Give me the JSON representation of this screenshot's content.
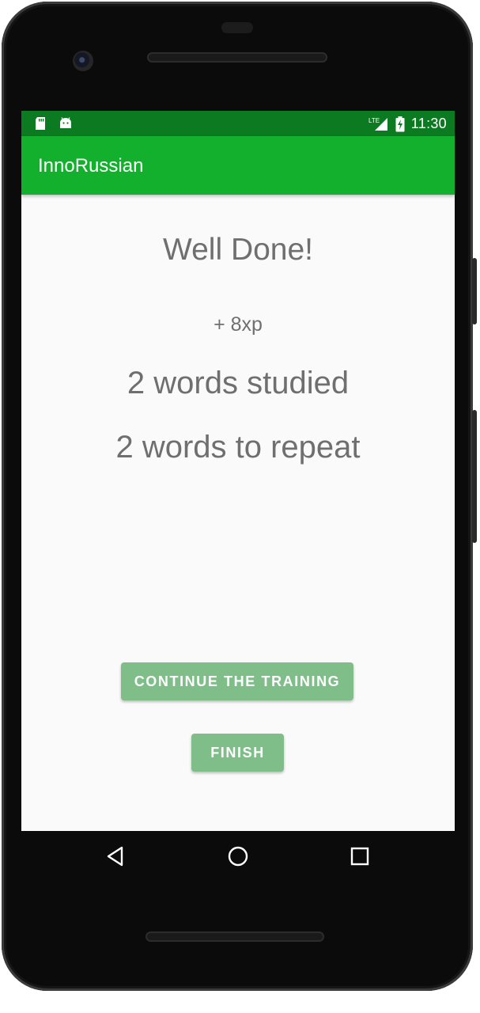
{
  "status_bar": {
    "time": "11:30",
    "network": "LTE",
    "icons": [
      "sd-card-icon",
      "android-icon",
      "lte-signal-icon",
      "battery-charging-icon"
    ]
  },
  "app_bar": {
    "title": "InnoRussian"
  },
  "result": {
    "headline": "Well Done!",
    "xp": "+ 8xp",
    "studied": "2 words studied",
    "repeat": "2 words to repeat"
  },
  "buttons": {
    "continue": "CONTINUE THE TRAINING",
    "finish": "FINISH"
  },
  "nav_bar": {
    "icons": [
      "back-icon",
      "home-icon",
      "recents-icon"
    ]
  },
  "colors": {
    "status_bar": "#0c7a20",
    "app_bar": "#12b02c",
    "button": "#7fbd89",
    "text": "#6f6f6f",
    "background": "#fafafa"
  }
}
